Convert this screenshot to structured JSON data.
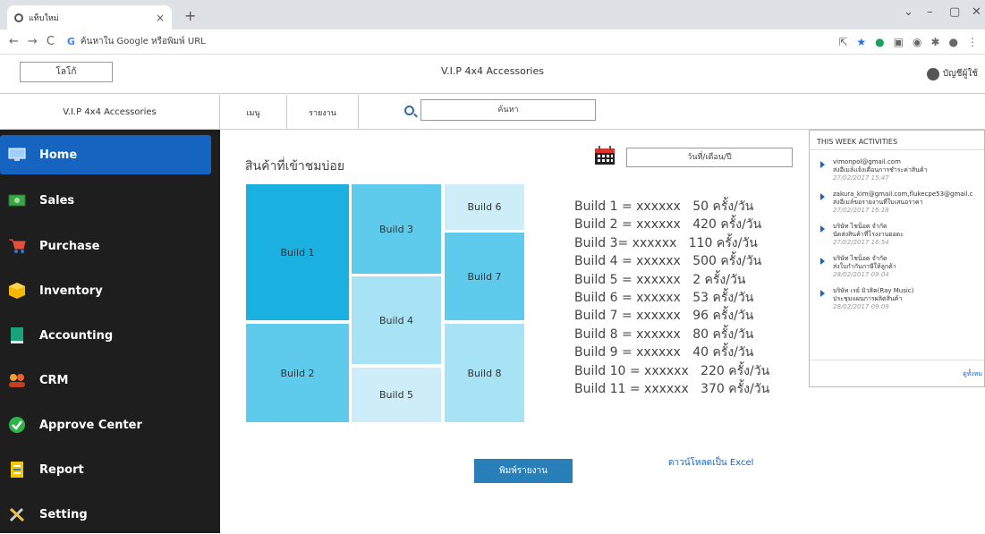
{
  "browser": {
    "tab_title": "แท็บใหม่",
    "tab_close": "×",
    "new_tab": "+",
    "address_placeholder": "ค้นหาใน Google หรือพิมพ์ URL",
    "google_g": "G",
    "back": "←",
    "forward": "→",
    "reload": "C"
  },
  "header": {
    "logo": "โลโก้",
    "title": "V.I.P 4x4 Accessories",
    "account": "บัญชีผู้ใช้"
  },
  "subheader": {
    "brand": "V.I.P 4x4 Accessories",
    "menu_items": [
      "เมนู",
      "รายงาน"
    ],
    "search_placeholder": "ค้นหา"
  },
  "sidebar": {
    "items": [
      {
        "label": "Home",
        "icon": "monitor-icon",
        "active": true
      },
      {
        "label": "Sales",
        "icon": "money-icon"
      },
      {
        "label": "Purchase",
        "icon": "cart-icon"
      },
      {
        "label": "Inventory",
        "icon": "box-icon"
      },
      {
        "label": "Accounting",
        "icon": "book-icon"
      },
      {
        "label": "CRM",
        "icon": "people-icon"
      },
      {
        "label": "Approve Center",
        "icon": "check-icon"
      },
      {
        "label": "Report",
        "icon": "report-icon"
      },
      {
        "label": "Setting",
        "icon": "tools-icon"
      }
    ]
  },
  "main": {
    "title": "สินค้าที่เข้าชมบ่อย",
    "date_placeholder": "วันที่/เดือน/ปี",
    "tiles": [
      "Build 1",
      "Build 2",
      "Build 3",
      "Build 4",
      "Build 5",
      "Build 6",
      "Build 7",
      "Build 8"
    ],
    "legend": [
      "Build 1 = xxxxxx   50 ครั้ง/วัน",
      "Build 2 = xxxxxx   420 ครั้ง/วัน",
      "Build 3= xxxxxx   110 ครั้ง/วัน",
      "Build 4 = xxxxxx   500 ครั้ง/วัน",
      "Build 5 = xxxxxx   2 ครั้ง/วัน",
      "Build 6 = xxxxxx   53 ครั้ง/วัน",
      "Build 7 = xxxxxx   96 ครั้ง/วัน",
      "Build 8 = xxxxxx   80 ครั้ง/วัน",
      "Build 9 = xxxxxx   40 ครั้ง/วัน",
      "Build 10 = xxxxxx   220 ครั้ง/วัน",
      "Build 11 = xxxxxx   370 ครั้ง/วัน"
    ],
    "print_button": "พิมพ์รายงาน",
    "excel_link": "ดาวน์โหลดเป็น Excel"
  },
  "activities": {
    "title": "THIS WEEK ACTIVITIES",
    "items": [
      {
        "who": "vimonpol@gmail.com",
        "what": "ส่งอีเมล์แจ้งเตือนการชำระค่าสินค้า",
        "when": "27/02/2017 15:47"
      },
      {
        "who": "zakura_kim@gmail.com,flukecpe53@gmail.c",
        "what": "ส่งอีเมล์ขอรายงานที่ใบเสนอราคา",
        "when": "27/02/2017 16:18"
      },
      {
        "who": "บริษัท ไชน็อต จำกัด",
        "what": "นัดส่งสินค้าที่โรงงานยอดะ",
        "when": "27/02/2017 16:54"
      },
      {
        "who": "บริษัท ไชน็อต จำกัด",
        "what": "ส่งใบกำกับภาษีให้ลูกค้า",
        "when": "28/02/2017 09:04"
      },
      {
        "who": "บริษัท เรย์ มิวสิค(Ray Music)",
        "what": "ประชุมแผนการผลิตสินค้า",
        "when": "28/02/2017 09:09"
      }
    ],
    "more": "ดูทั้งหม"
  },
  "colors": {
    "sidebar_bg": "#1e1e1e",
    "sidebar_active": "#1565c0",
    "tile_dark": "#1ab0e0",
    "tile_mid": "#5fcbec",
    "tile_light": "#a8e2f5",
    "tile_pale": "#cdeef9",
    "print_button": "#2980b9"
  }
}
